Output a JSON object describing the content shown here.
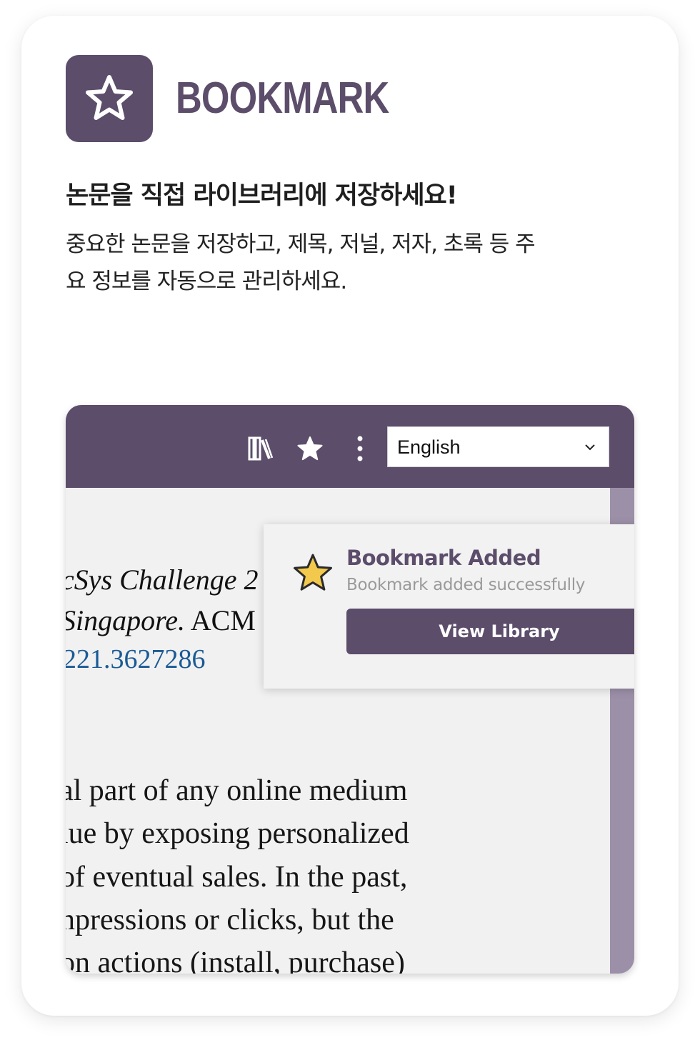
{
  "header": {
    "icon": "star-outline-icon",
    "title": "BOOKMARK"
  },
  "subtitle": "논문을 직접 라이브러리에 저장하세요!",
  "description_lines": [
    "중요한 논문을 저장하고, 제목, 저널, 저자, 초록 등 주",
    "요 정보를 자동으로 관리하세요."
  ],
  "mockup": {
    "toolbar": {
      "icons": [
        "library-icon",
        "star-icon",
        "more-vertical-icon"
      ],
      "language_select": {
        "value": "English"
      }
    },
    "paper": {
      "reference_line_1": "cSys Challenge 2",
      "reference_line_2_italic": "Singapore.",
      "reference_line_2_rest": " ACM",
      "reference_doi": "221.3627286",
      "body_lines": [
        "al part of any online medium",
        "lue by exposing personalized",
        "of eventual sales. In the past,",
        "npressions or clicks, but the",
        "on actions (install, purchase)"
      ]
    },
    "popup": {
      "icon": "star-filled-icon",
      "title": "Bookmark Added",
      "message": "Bookmark added successfully",
      "button_label": "View Library"
    }
  },
  "colors": {
    "brand": "#5c4d6b",
    "scrollbar": "#9c90a8",
    "star_fill": "#f2c94c",
    "link": "#1a5a96"
  }
}
